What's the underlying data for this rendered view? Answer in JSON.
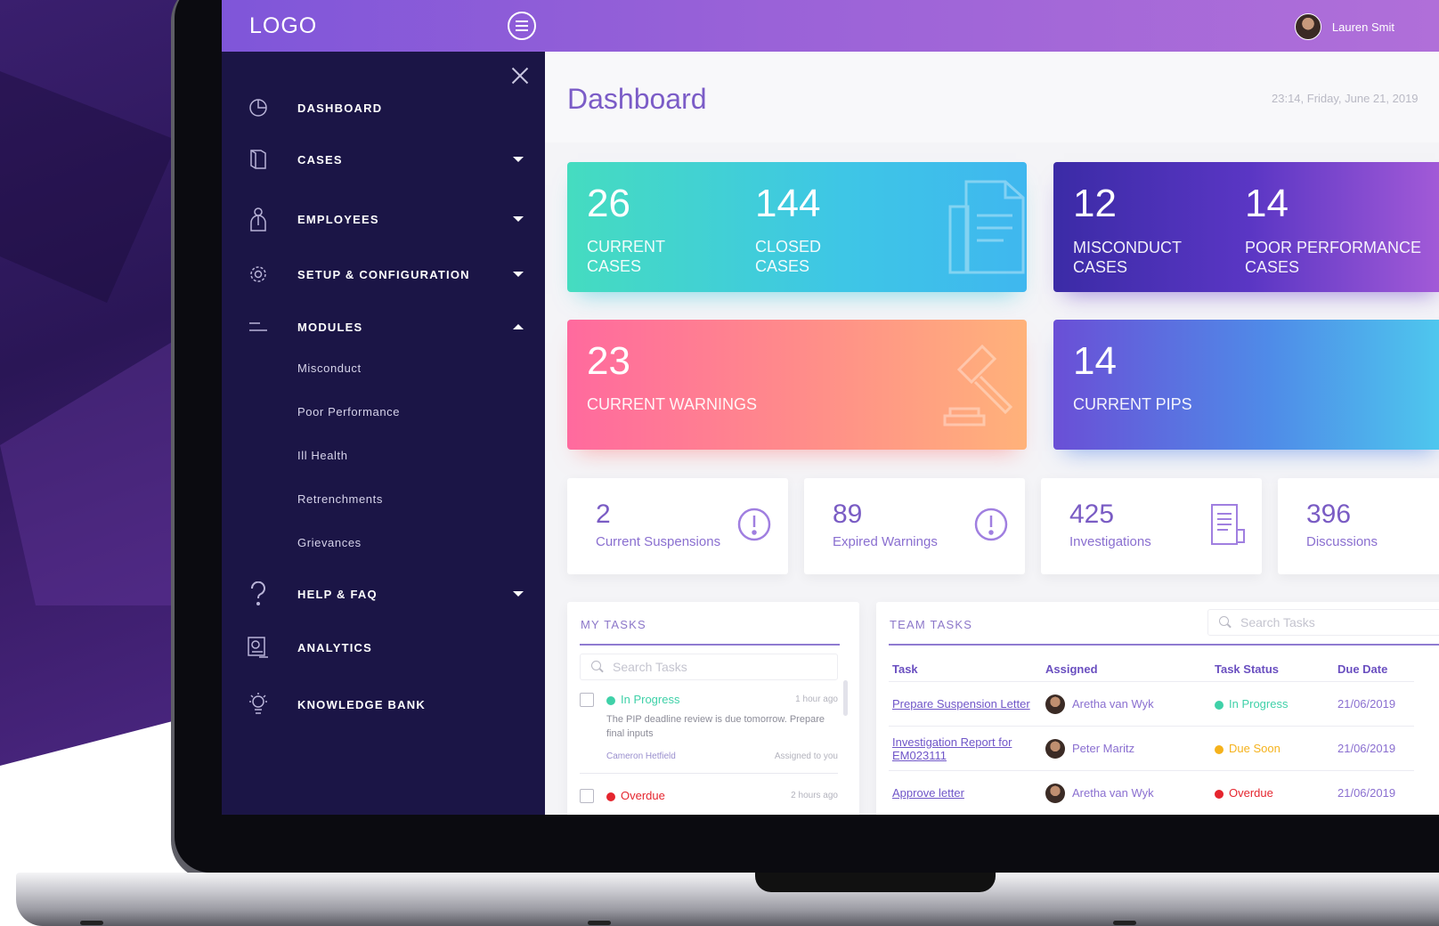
{
  "app": {
    "logo": "LOGO",
    "user_name": "Lauren Smit"
  },
  "sidebar": {
    "items": [
      {
        "label": "DASHBOARD",
        "icon": "dashboard-icon",
        "caret": ""
      },
      {
        "label": "CASES",
        "icon": "cases-icon",
        "caret": "down"
      },
      {
        "label": "EMPLOYEES",
        "icon": "employees-icon",
        "caret": "down"
      },
      {
        "label": "SETUP & CONFIGURATION",
        "icon": "gear-icon",
        "caret": "down"
      },
      {
        "label": "MODULES",
        "icon": "modules-icon",
        "caret": "up"
      },
      {
        "label": "HELP & FAQ",
        "icon": "help-icon",
        "caret": "down"
      },
      {
        "label": "ANALYTICS",
        "icon": "analytics-icon",
        "caret": ""
      },
      {
        "label": "KNOWLEDGE BANK",
        "icon": "lightbulb-icon",
        "caret": ""
      }
    ],
    "modules": [
      "Misconduct",
      "Poor Performance",
      "Ill Health",
      "Retrenchments",
      "Grievances"
    ]
  },
  "main": {
    "title": "Dashboard",
    "datetime": "23:14, Friday, June 21, 2019"
  },
  "cards": {
    "current_cases": {
      "value": "26",
      "label1": "CURRENT",
      "label2": "CASES"
    },
    "closed_cases": {
      "value": "144",
      "label1": "CLOSED",
      "label2": "CASES"
    },
    "misconduct_cases": {
      "value": "12",
      "label1": "MISCONDUCT",
      "label2": "CASES"
    },
    "poor_performance_cases": {
      "value": "14",
      "label1": "POOR PERFORMANCE",
      "label2": "CASES"
    },
    "current_warnings": {
      "value": "23",
      "label": "CURRENT WARNINGS"
    },
    "current_pips": {
      "value": "14",
      "label": "CURRENT PIPS"
    }
  },
  "stats": [
    {
      "value": "2",
      "label": "Current Suspensions",
      "icon": "alert-icon"
    },
    {
      "value": "89",
      "label": "Expired Warnings",
      "icon": "alert-icon"
    },
    {
      "value": "425",
      "label": "Investigations",
      "icon": "document-icon"
    },
    {
      "value": "396",
      "label": "Discussions",
      "icon": ""
    }
  ],
  "my_tasks": {
    "title": "MY TASKS",
    "search_placeholder": "Search Tasks",
    "items": [
      {
        "status": "In Progress",
        "status_color": "#3fd1a8",
        "time": "1 hour ago",
        "desc": "The PIP deadline review is due tomorrow. Prepare final inputs",
        "person": "Cameron Hetfield",
        "assigned": "Assigned to you"
      },
      {
        "status": "Overdue",
        "status_color": "#e5252e",
        "time": "2 hours ago"
      }
    ]
  },
  "team_tasks": {
    "title": "TEAM TASKS",
    "search_placeholder": "Search Tasks",
    "columns": [
      "Task",
      "Assigned",
      "Task Status",
      "Due Date"
    ],
    "rows": [
      {
        "task": "Prepare Suspension Letter",
        "assigned": "Aretha van Wyk",
        "status": "In Progress",
        "status_color": "#3fd1a8",
        "due": "21/06/2019"
      },
      {
        "task": "Investigation Report for EM023111",
        "assigned": "Peter Maritz",
        "status": "Due Soon",
        "status_color": "#f5b21c",
        "due": "21/06/2019"
      },
      {
        "task": "Approve letter",
        "assigned": "Aretha van Wyk",
        "status": "Overdue",
        "status_color": "#e5252e",
        "due": "21/06/2019"
      }
    ]
  }
}
